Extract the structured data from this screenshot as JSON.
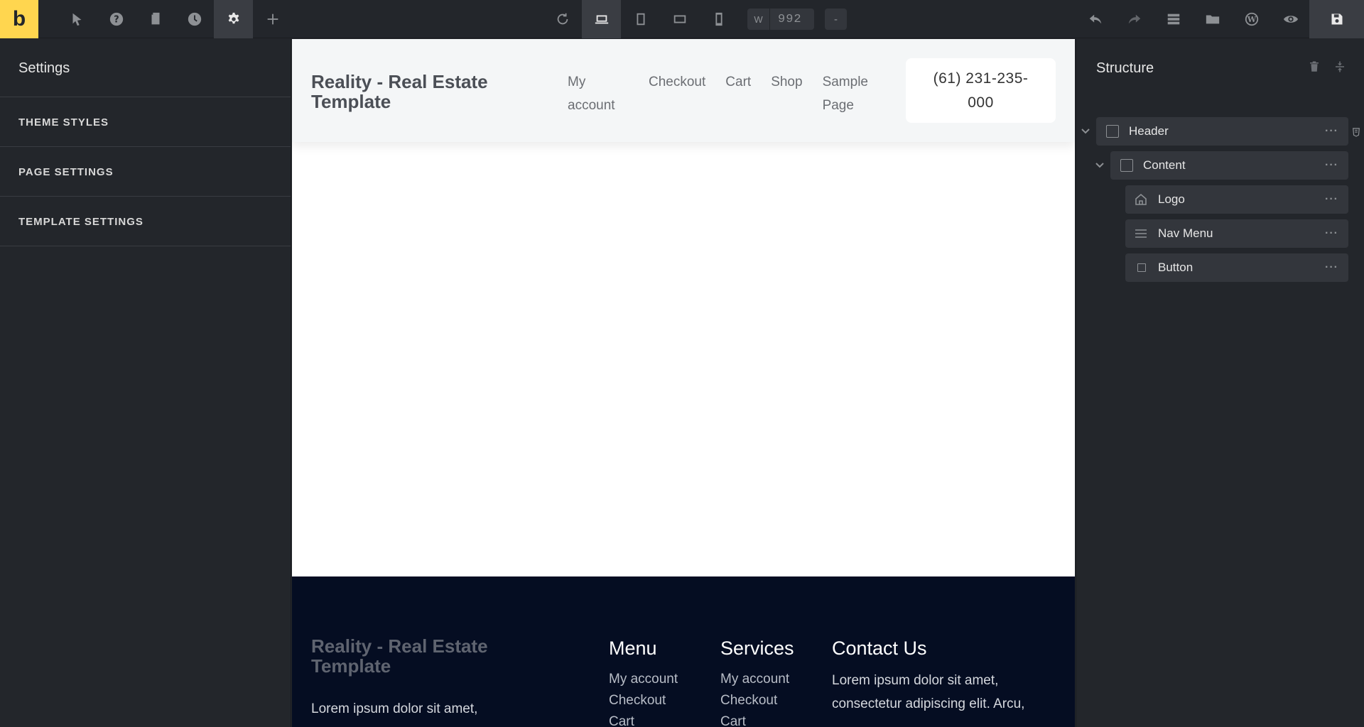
{
  "app": {
    "logo": "b"
  },
  "toolbar": {
    "width_label": "W",
    "width_value": "992",
    "dash": "-"
  },
  "left_panel": {
    "title": "Settings",
    "items": [
      "THEME STYLES",
      "PAGE SETTINGS",
      "TEMPLATE SETTINGS"
    ]
  },
  "canvas": {
    "header": {
      "logo": "Reality - Real Estate Template",
      "nav": [
        "My account",
        "Checkout",
        "Cart",
        "Shop",
        "Sample Page"
      ],
      "button": "(61) 231-235-000"
    },
    "footer": {
      "logo": "Reality - Real Estate Template",
      "text": "Lorem ipsum dolor sit amet,",
      "menu_title": "Menu",
      "menu_links": [
        "My account",
        "Checkout",
        "Cart"
      ],
      "services_title": "Services",
      "services_links": [
        "My account",
        "Checkout",
        "Cart"
      ],
      "contact_title": "Contact Us",
      "contact_text": "Lorem ipsum dolor sit amet, consectetur adipiscing elit. Arcu,"
    }
  },
  "structure": {
    "title": "Structure",
    "items": [
      {
        "label": "Header",
        "icon": "section-box-icon"
      },
      {
        "label": "Content",
        "icon": "container-box-icon"
      },
      {
        "label": "Logo",
        "icon": "home-icon"
      },
      {
        "label": "Nav Menu",
        "icon": "menu-lines-icon"
      },
      {
        "label": "Button",
        "icon": "square-icon"
      }
    ],
    "more": "···"
  },
  "colors": {
    "brand": "#ffd64f",
    "toolbar_bg": "#23262b",
    "active_tool": "#3a3d43",
    "footer_bg": "#050d22"
  }
}
